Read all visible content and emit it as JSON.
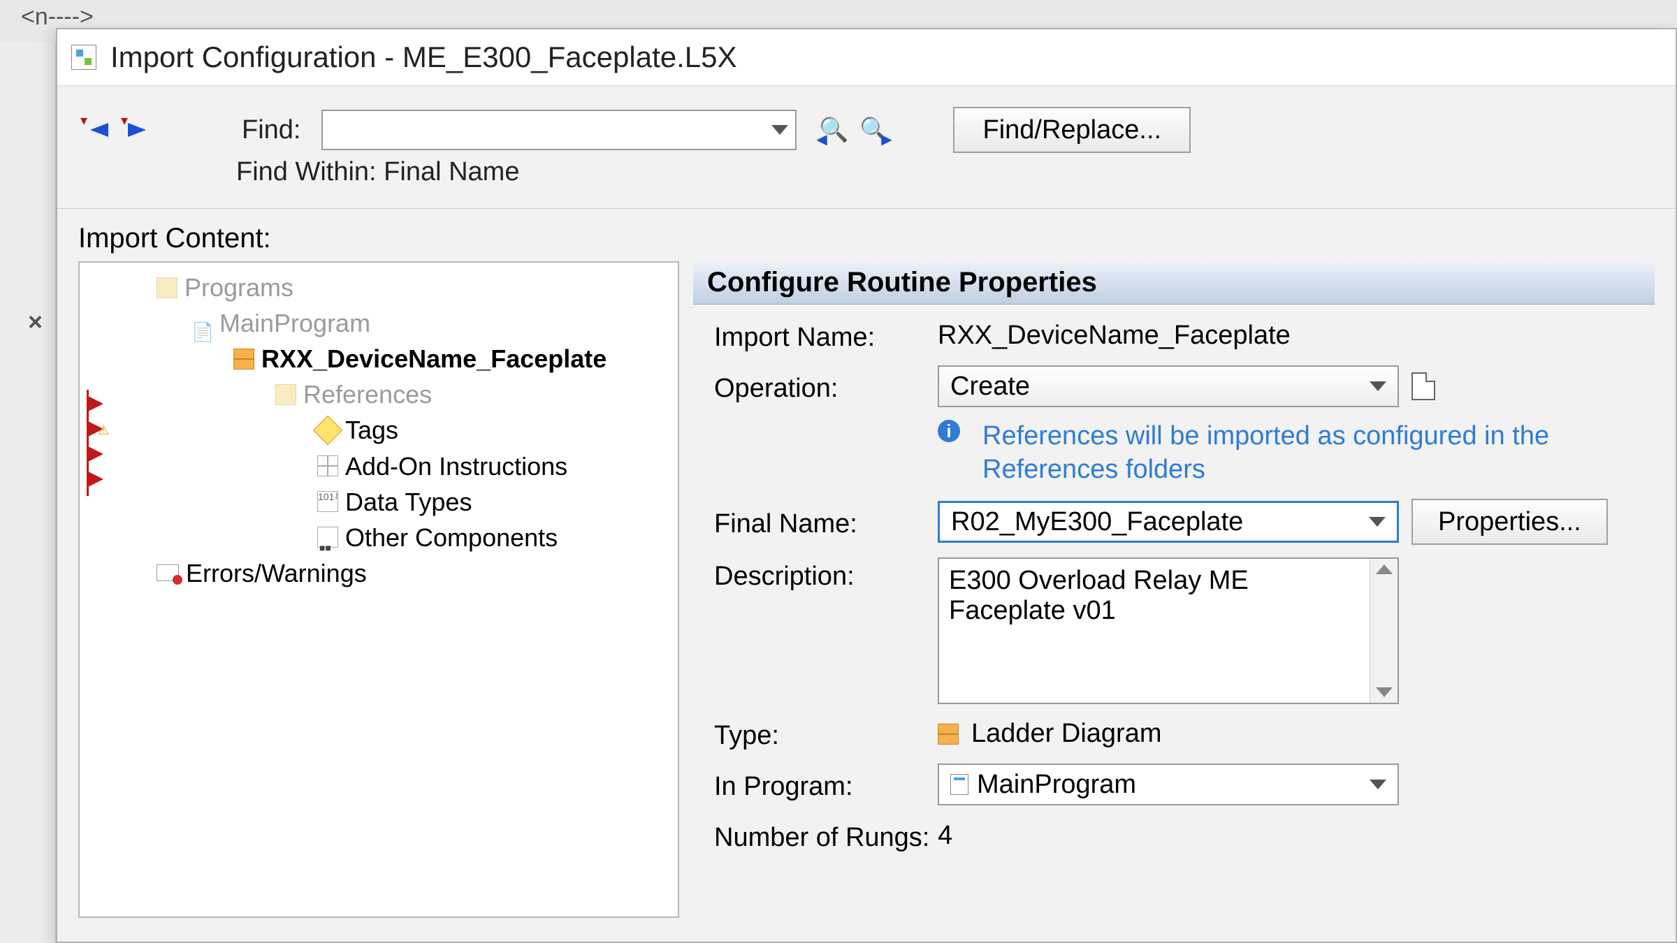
{
  "bg_tag": "<n---->",
  "dialog": {
    "title": "Import Configuration - ME_E300_Faceplate.L5X"
  },
  "find": {
    "label": "Find:",
    "value": "",
    "within_label": "Find Within: Final Name",
    "replace_button": "Find/Replace..."
  },
  "import_content_label": "Import Content:",
  "tree": {
    "programs": "Programs",
    "main_program": "MainProgram",
    "routine": "RXX_DeviceName_Faceplate",
    "references": "References",
    "tags": "Tags",
    "aoi": "Add-On Instructions",
    "data_types": "Data Types",
    "other": "Other Components",
    "errors": "Errors/Warnings"
  },
  "props": {
    "header": "Configure Routine Properties",
    "import_name_label": "Import Name:",
    "import_name_value": "RXX_DeviceName_Faceplate",
    "operation_label": "Operation:",
    "operation_value": "Create",
    "info_text": "References will be imported as configured in the References folders",
    "final_name_label": "Final Name:",
    "final_name_value": "R02_MyE300_Faceplate",
    "properties_button": "Properties...",
    "description_label": "Description:",
    "description_value": "E300 Overload Relay ME Faceplate v01",
    "type_label": "Type:",
    "type_value": "Ladder Diagram",
    "in_program_label": "In Program:",
    "in_program_value": "MainProgram",
    "rungs_label": "Number of Rungs:",
    "rungs_value": "4"
  }
}
